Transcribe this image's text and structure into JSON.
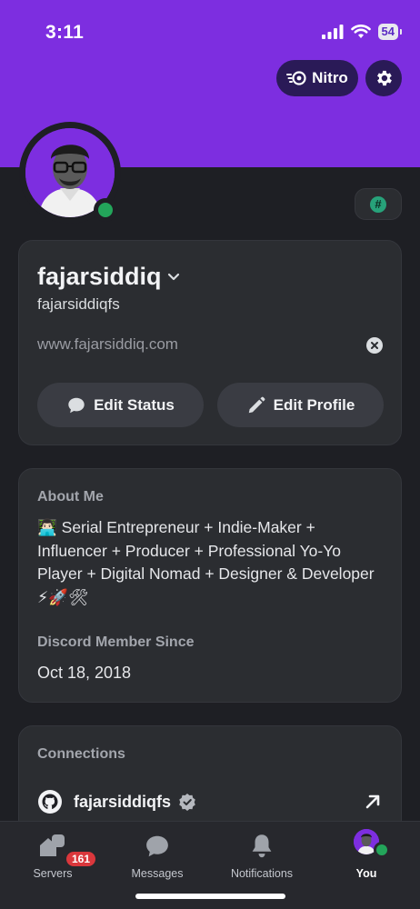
{
  "status_bar": {
    "time": "3:11",
    "battery": "54"
  },
  "header": {
    "nitro_label": "Nitro",
    "nitro_icon": "nitro-icon",
    "settings_icon": "gear-icon",
    "banner_color": "#7d2ee0"
  },
  "profile": {
    "display_name": "fajarsiddiq",
    "username": "fajarsiddiqfs",
    "website": "www.fajarsiddiq.com",
    "presence": "online",
    "edit_status_label": "Edit Status",
    "edit_profile_label": "Edit Profile"
  },
  "about": {
    "title": "About Me",
    "text": "👨🏻‍💻 Serial Entrepreneur + Indie-Maker + Influencer + Producer + Professional Yo-Yo Player + Digital Nomad + Designer & Developer ⚡🚀🛠",
    "member_since_title": "Discord Member Since",
    "member_since": "Oct 18, 2018"
  },
  "connections": {
    "title": "Connections",
    "items": [
      {
        "service": "github",
        "name": "fajarsiddiqfs",
        "verified": true
      }
    ]
  },
  "tabbar": {
    "tabs": [
      {
        "label": "Servers",
        "badge": "161"
      },
      {
        "label": "Messages"
      },
      {
        "label": "Notifications"
      },
      {
        "label": "You"
      }
    ]
  },
  "colors": {
    "online": "#23a55a",
    "badge": "#da373c",
    "nitro_pill": "#2a1a57"
  }
}
